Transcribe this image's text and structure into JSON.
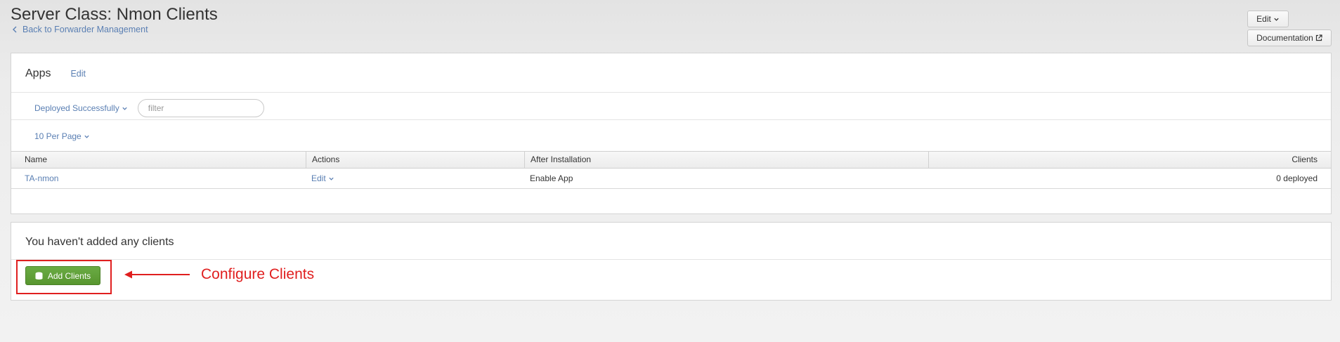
{
  "header": {
    "title": "Server Class: Nmon Clients",
    "back_link": "Back to Forwarder Management",
    "edit_button": "Edit",
    "documentation_button": "Documentation"
  },
  "apps": {
    "title": "Apps",
    "edit_link": "Edit",
    "status_filter": "Deployed Successfully",
    "filter_placeholder": "filter",
    "per_page": "10 Per Page",
    "columns": [
      "Name",
      "Actions",
      "After Installation",
      "Clients"
    ],
    "rows": [
      {
        "name": "TA-nmon",
        "action": "Edit",
        "after_installation": "Enable App",
        "clients": "0 deployed"
      }
    ]
  },
  "clients": {
    "empty_message": "You haven't added any clients",
    "add_button": "Add Clients",
    "annotation": "Configure Clients"
  },
  "colors": {
    "link": "#5a7fb3",
    "primary_button": "#5fa03a",
    "annotation": "#e01f1f"
  },
  "icons": [
    "chevron-left-icon",
    "chevron-down-icon",
    "external-link-icon",
    "database-icon",
    "arrow-left-icon"
  ]
}
